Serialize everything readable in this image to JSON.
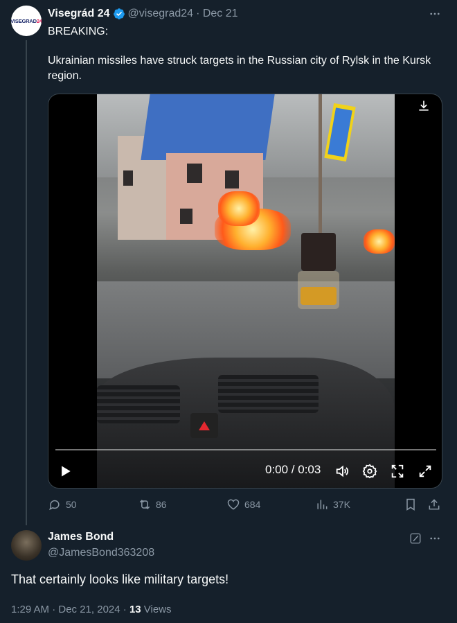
{
  "tweet": {
    "author_name": "Visegrád 24",
    "avatar_logo": "VISEGRAD24",
    "handle": "@visegrad24",
    "date": "· Dec 21",
    "line1": "BREAKING:",
    "line2": "Ukrainian missiles have struck targets in the Russian city of Rylsk in the Kursk region.",
    "verified_icon": "verified-badge-icon",
    "video": {
      "time": "0:00 / 0:03",
      "progress": 0.0
    },
    "stats": {
      "replies": "50",
      "reposts": "86",
      "likes": "684",
      "views": "37K"
    }
  },
  "reply": {
    "author_name": "James Bond",
    "handle": "@JamesBond363208",
    "text": "That certainly looks like military targets!",
    "timestamp": "1:29 AM · Dec 21, 2024 · ",
    "views_count": "13",
    "views_label": " Views"
  },
  "colors": {
    "background": "#15202b",
    "text": "#f7f9f9",
    "muted": "#8b98a5",
    "verified": "#1d9bf0"
  }
}
